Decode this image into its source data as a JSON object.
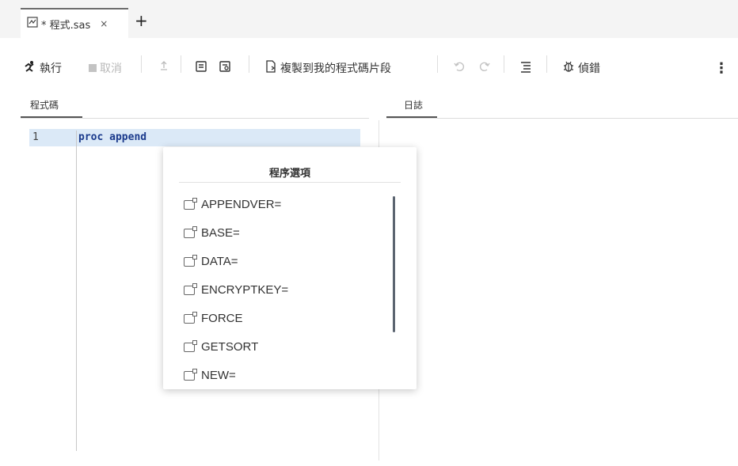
{
  "tab": {
    "title": "* 程式.sas",
    "close": "×",
    "add": "+"
  },
  "toolbar": {
    "run": "執行",
    "cancel": "取消",
    "copy_snippet": "複製到我的程式碼片段",
    "debug": "偵錯",
    "more": "⋮"
  },
  "panes": {
    "code": "程式碼",
    "log": "日誌"
  },
  "editor": {
    "line_number": "1",
    "code": "proc append"
  },
  "popup": {
    "title": "程序選項",
    "options": [
      "APPENDVER=",
      "BASE=",
      "DATA=",
      "ENCRYPTKEY=",
      "FORCE",
      "GETSORT",
      "NEW="
    ]
  }
}
